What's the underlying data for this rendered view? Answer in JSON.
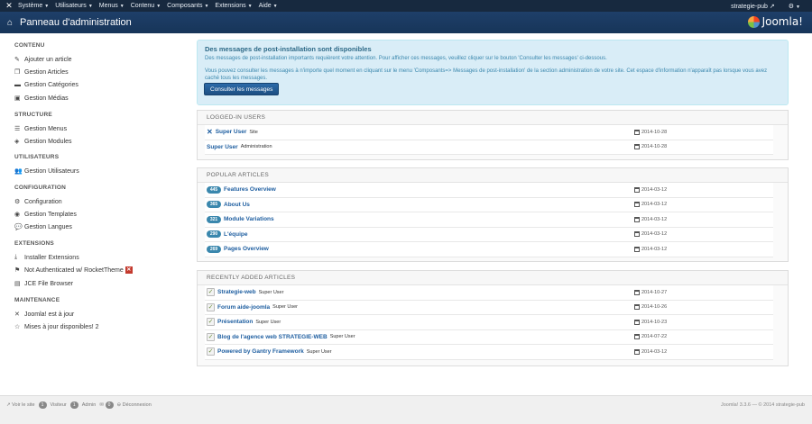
{
  "navbar": {
    "logo_icon": "joomla-icon",
    "items": [
      "Système",
      "Utilisateurs",
      "Menus",
      "Contenu",
      "Composants",
      "Extensions",
      "Aide"
    ],
    "user": "strategie-pub",
    "settings_icon": "gear-icon"
  },
  "titlebar": {
    "title": "Panneau d'administration",
    "home_icon": "home-icon",
    "brand": "Joomla!"
  },
  "sidebar": {
    "sections": [
      {
        "heading": "CONTENU",
        "items": [
          {
            "label": "Ajouter un article",
            "icon": "pencil-icon"
          },
          {
            "label": "Gestion Articles",
            "icon": "copy-icon"
          },
          {
            "label": "Gestion Catégories",
            "icon": "folder-icon"
          },
          {
            "label": "Gestion Médias",
            "icon": "image-icon"
          }
        ]
      },
      {
        "heading": "STRUCTURE",
        "items": [
          {
            "label": "Gestion Menus",
            "icon": "list-icon"
          },
          {
            "label": "Gestion Modules",
            "icon": "cube-icon"
          }
        ]
      },
      {
        "heading": "UTILISATEURS",
        "items": [
          {
            "label": "Gestion Utilisateurs",
            "icon": "users-icon"
          }
        ]
      },
      {
        "heading": "CONFIGURATION",
        "items": [
          {
            "label": "Configuration",
            "icon": "gear-icon"
          },
          {
            "label": "Gestion Templates",
            "icon": "eye-icon"
          },
          {
            "label": "Gestion Langues",
            "icon": "comment-icon"
          }
        ]
      },
      {
        "heading": "EXTENSIONS",
        "items": [
          {
            "label": "Installer Extensions",
            "icon": "download-icon"
          },
          {
            "label": "Not Authenticated w/ RocketTheme",
            "icon": "flag-icon"
          },
          {
            "label": "JCE File Browser",
            "icon": "file-icon"
          }
        ]
      },
      {
        "heading": "MAINTENANCE",
        "items": [
          {
            "label": "Joomla! est à jour",
            "icon": "joomla-icon"
          },
          {
            "label": "Mises à jour disponibles! 2",
            "icon": "star-icon"
          }
        ]
      }
    ],
    "error_badge": "✕"
  },
  "alert": {
    "title": "Des messages de post-installation sont disponibles",
    "line1": "Des messages de post-installation importants requièrent votre attention. Pour afficher ces messages, veuillez cliquer sur le bouton 'Consulter les messages' ci-dessous.",
    "line2": "Vous pouvez consulter les messages à n'importe quel moment en cliquant sur le menu 'Composants=> Messages de post-installation' de la section administration de votre site. Cet espace d'information n'apparaît pas lorsque vous avez caché tous les messages.",
    "button": "Consulter les messages"
  },
  "logged_in": {
    "heading": "LOGGED-IN USERS",
    "rows": [
      {
        "name": "Super User",
        "sub": "Site",
        "date": "2014-10-28",
        "icon": "close-icon"
      },
      {
        "name": "Super User",
        "sub": "Administration",
        "date": "2014-10-28"
      }
    ]
  },
  "popular": {
    "heading": "POPULAR ARTICLES",
    "rows": [
      {
        "hits": "445",
        "title": "Features Overview",
        "date": "2014-03-12"
      },
      {
        "hits": "365",
        "title": "About Us",
        "date": "2014-03-12"
      },
      {
        "hits": "321",
        "title": "Module Variations",
        "date": "2014-03-12"
      },
      {
        "hits": "290",
        "title": "L'équipe",
        "date": "2014-03-12"
      },
      {
        "hits": "269",
        "title": "Pages Overview",
        "date": "2014-03-12"
      }
    ]
  },
  "recent": {
    "heading": "RECENTLY ADDED ARTICLES",
    "rows": [
      {
        "title": "Strategie-web",
        "author": "Super User",
        "date": "2014-10-27"
      },
      {
        "title": "Forum aide-joomla",
        "author": "Super User",
        "date": "2014-10-26"
      },
      {
        "title": "Présentation",
        "author": "Super User",
        "date": "2014-10-23"
      },
      {
        "title": "Blog de l'agence web STRATEGIE-WEB",
        "author": "Super User",
        "date": "2014-07-22"
      },
      {
        "title": "Powered by Gantry Framework",
        "author": "Super User",
        "date": "2014-03-12"
      }
    ]
  },
  "footer": {
    "view_site": "Voir le site",
    "visitors_count": "1",
    "visitors": "Visiteur",
    "admin_count": "1",
    "admin": "Admin",
    "messages_count": "0",
    "logout": "Déconnexion",
    "copyright": "Joomla! 3.3.6 — © 2014 strategie-pub"
  }
}
